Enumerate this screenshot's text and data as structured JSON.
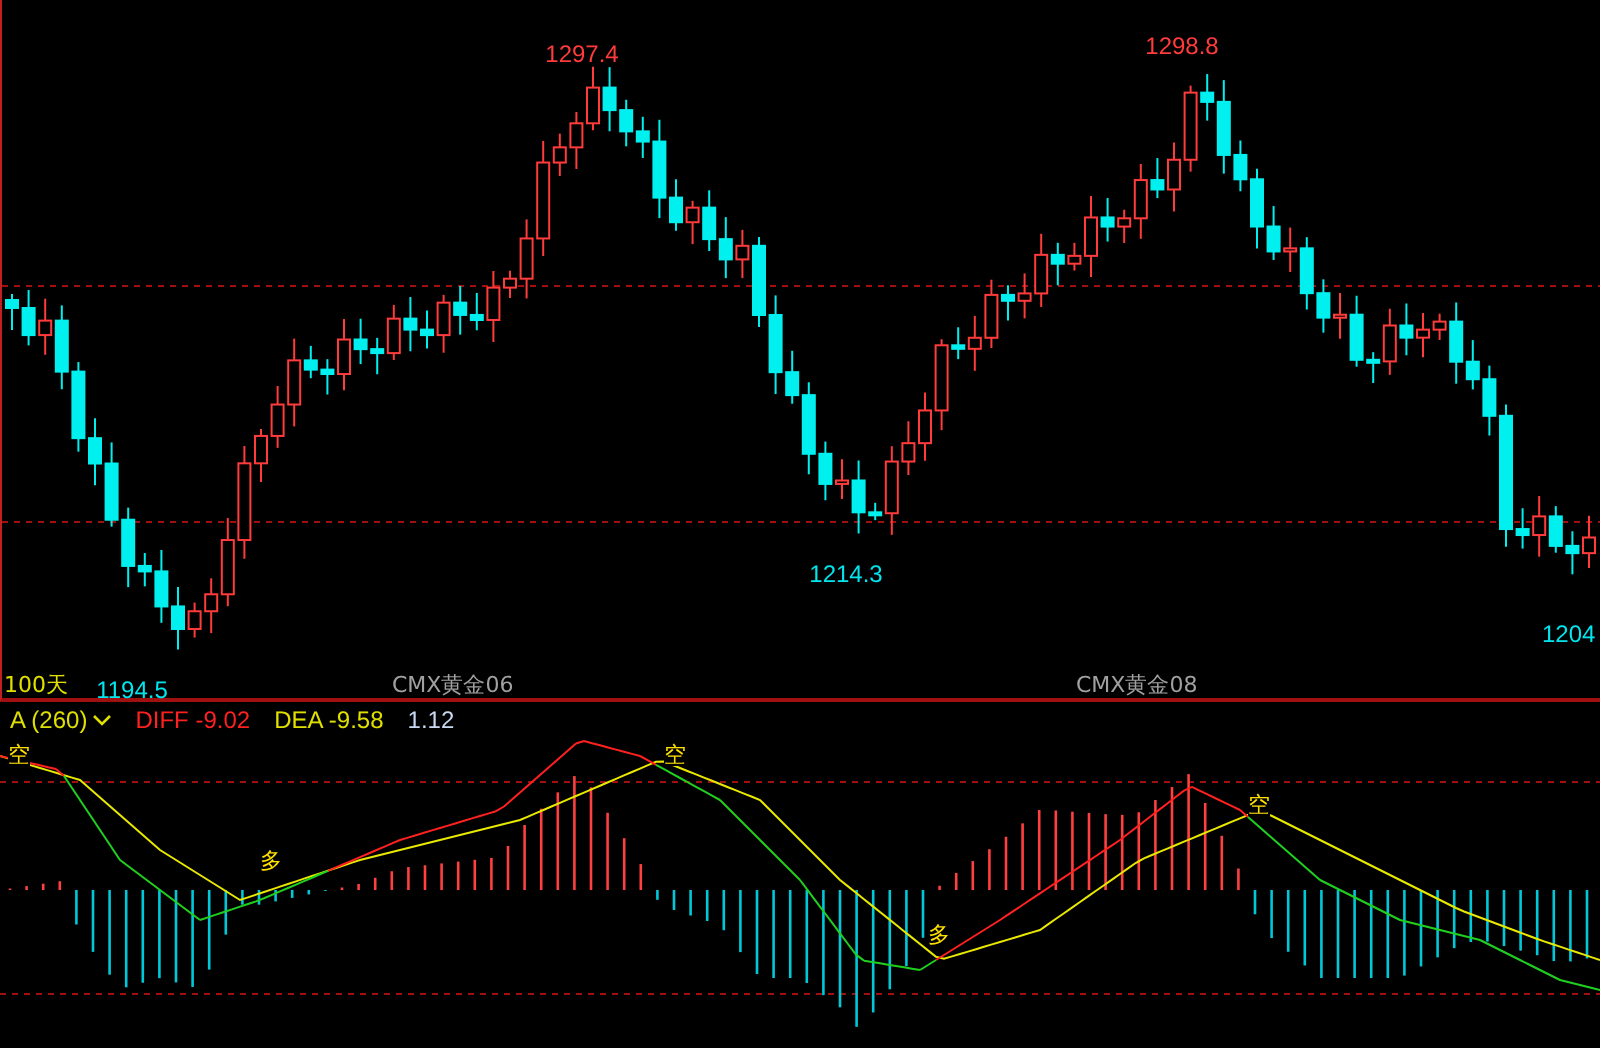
{
  "price_panel": {
    "extreme_labels": [
      {
        "text": "1297.4",
        "kind": "high"
      },
      {
        "text": "1194.5",
        "kind": "low"
      },
      {
        "text": "1214.3",
        "kind": "low"
      },
      {
        "text": "1298.8",
        "kind": "high"
      },
      {
        "text": "1204",
        "kind": "low"
      }
    ],
    "period": "100天",
    "contract_labels": [
      "CMX黄金06",
      "CMX黄金08"
    ]
  },
  "macd_panel": {
    "indicator": "A (260)",
    "diff": "DIFF -9.02",
    "dea": "DEA -9.58",
    "macd": "1.12",
    "signals": [
      "空",
      "多",
      "空",
      "多",
      "空"
    ]
  }
}
